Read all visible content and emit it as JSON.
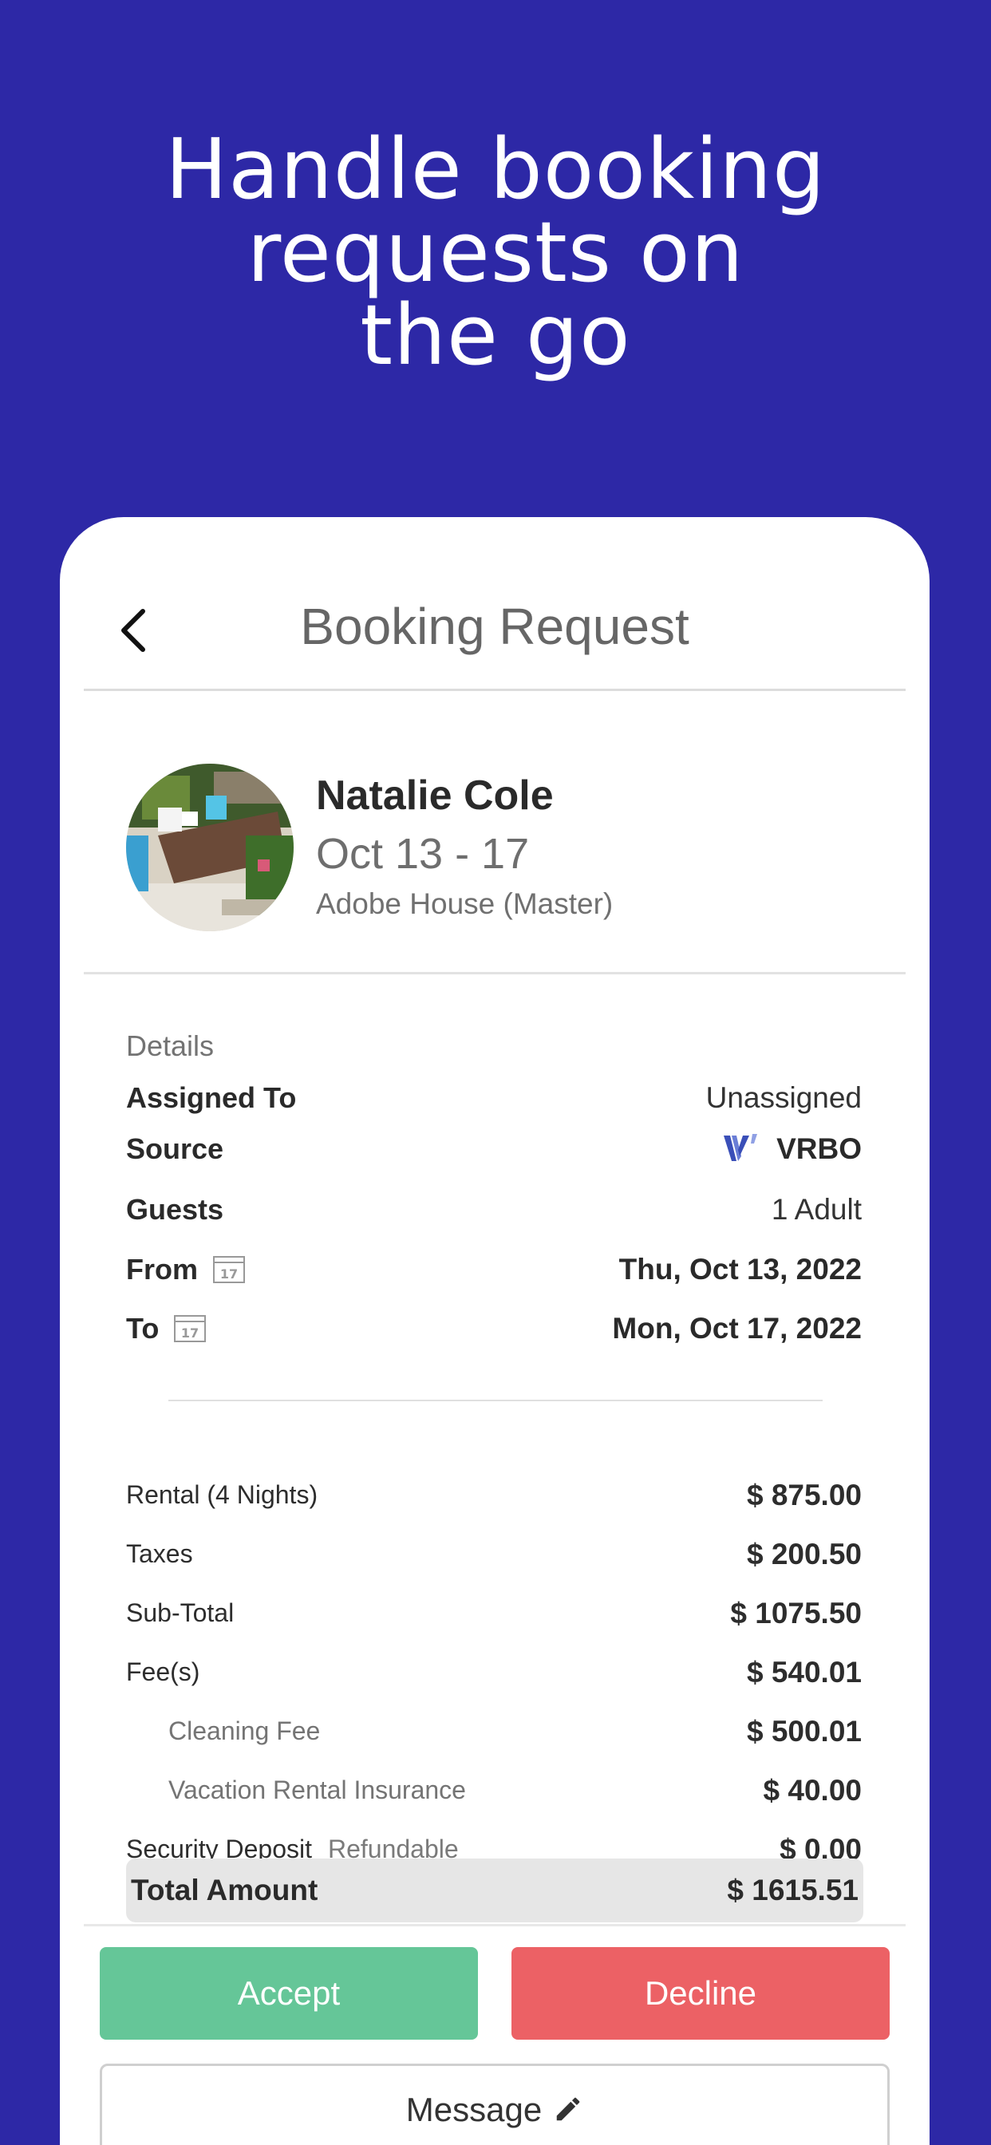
{
  "headline": {
    "line1": "Handle booking",
    "line2": "requests on",
    "line3": "the go"
  },
  "header": {
    "title": "Booking Request",
    "back_icon": "chevron-left-icon"
  },
  "guest": {
    "name": "Natalie Cole",
    "dates": "Oct 13 - 17",
    "property": "Adobe House (Master)"
  },
  "details": {
    "section_label": "Details",
    "rows": [
      {
        "label": "Assigned To",
        "value": "Unassigned"
      },
      {
        "label": "Source",
        "value": "VRBO",
        "icon": "vrbo-logo"
      },
      {
        "label": "Guests",
        "value": "1 Adult"
      },
      {
        "label": "From",
        "value": "Thu, Oct 13, 2022",
        "icon": "calendar-icon"
      },
      {
        "label": "To",
        "value": "Mon, Oct 17, 2022",
        "icon": "calendar-icon"
      }
    ]
  },
  "calendar_icon_text": "17",
  "pricing": {
    "rows": [
      {
        "label": "Rental (4 Nights)",
        "value": "$ 875.00"
      },
      {
        "label": "Taxes",
        "value": "$ 200.50"
      },
      {
        "label": "Sub-Total",
        "value": "$ 1075.50"
      },
      {
        "label": "Fee(s)",
        "value": "$ 540.01"
      },
      {
        "label": "Cleaning Fee",
        "value": "$ 500.01",
        "indent": true
      },
      {
        "label": "Vacation Rental Insurance",
        "value": "$ 40.00",
        "indent": true
      },
      {
        "label": "Security Deposit",
        "tag": "Refundable",
        "value": "$ 0.00"
      }
    ],
    "total_label": "Total Amount",
    "total_value": "$ 1615.51"
  },
  "actions": {
    "accept_label": "Accept",
    "decline_label": "Decline",
    "message_label": "Message"
  },
  "colors": {
    "background": "#2d28a6",
    "accept": "#65c698",
    "decline": "#ec6165",
    "vrbo": "#3a4fb8"
  }
}
